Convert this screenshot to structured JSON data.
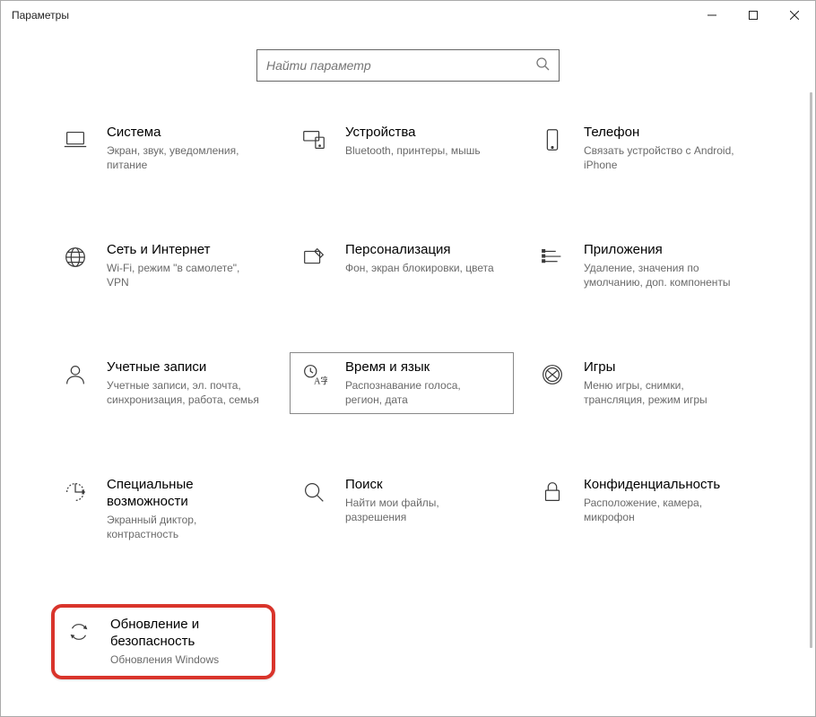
{
  "window": {
    "title": "Параметры"
  },
  "search": {
    "placeholder": "Найти параметр"
  },
  "tiles": {
    "system": {
      "title": "Система",
      "sub": "Экран, звук, уведомления, питание"
    },
    "devices": {
      "title": "Устройства",
      "sub": "Bluetooth, принтеры, мышь"
    },
    "phone": {
      "title": "Телефон",
      "sub": "Связать устройство с Android, iPhone"
    },
    "network": {
      "title": "Сеть и Интернет",
      "sub": "Wi-Fi, режим \"в самолете\", VPN"
    },
    "personal": {
      "title": "Персонализация",
      "sub": "Фон, экран блокировки, цвета"
    },
    "apps": {
      "title": "Приложения",
      "sub": "Удаление, значения по умолчанию, доп. компоненты"
    },
    "accounts": {
      "title": "Учетные записи",
      "sub": "Учетные записи, эл. почта, синхронизация, работа, семья"
    },
    "timelang": {
      "title": "Время и язык",
      "sub": "Распознавание голоса, регион, дата"
    },
    "gaming": {
      "title": "Игры",
      "sub": "Меню игры, снимки, трансляция, режим игры"
    },
    "ease": {
      "title": "Специальные возможности",
      "sub": "Экранный диктор, контрастность"
    },
    "searchcat": {
      "title": "Поиск",
      "sub": "Найти мои файлы, разрешения"
    },
    "privacy": {
      "title": "Конфиденциальность",
      "sub": "Расположение, камера, микрофон"
    },
    "update": {
      "title": "Обновление и безопасность",
      "sub": "Обновления Windows"
    }
  }
}
